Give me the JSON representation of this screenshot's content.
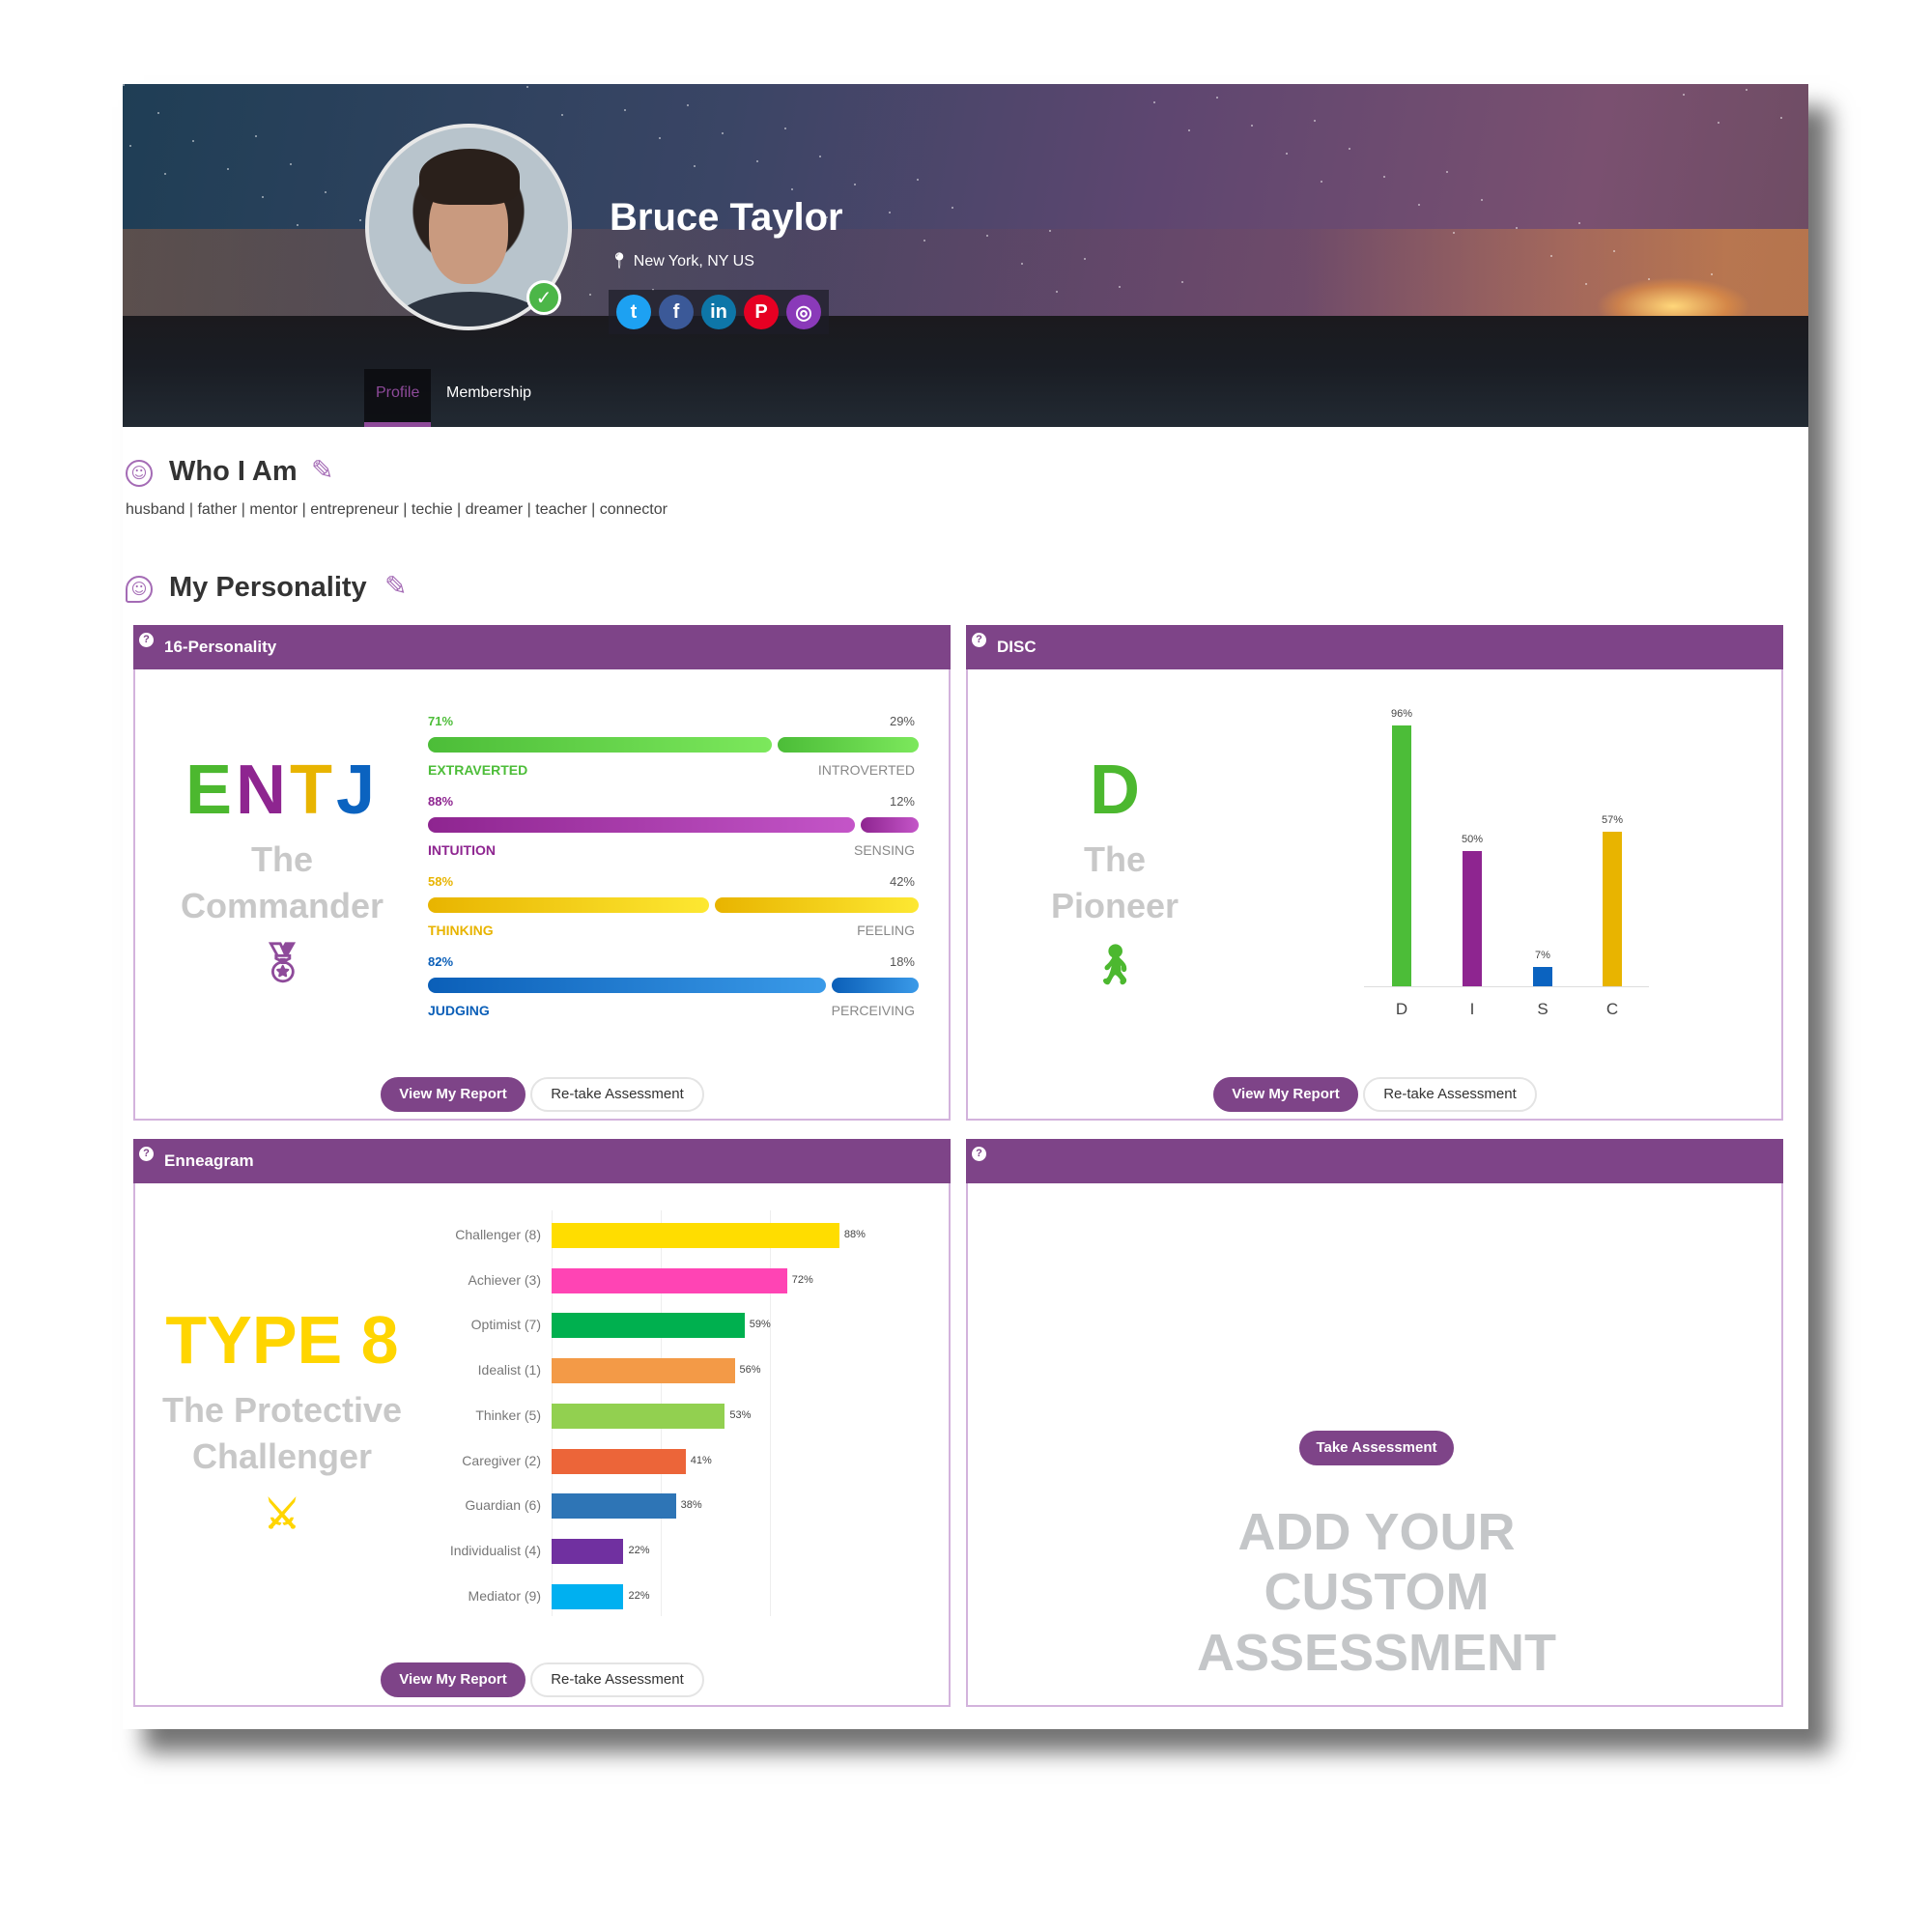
{
  "profile": {
    "name": "Bruce Taylor",
    "location": "New York, NY US",
    "verified": true,
    "social": [
      {
        "icon": "twitter-icon",
        "glyph": "t",
        "color": "#1da1f2"
      },
      {
        "icon": "facebook-icon",
        "glyph": "f",
        "color": "#3b5998"
      },
      {
        "icon": "linkedin-icon",
        "glyph": "in",
        "color": "#0e76a8"
      },
      {
        "icon": "pinterest-icon",
        "glyph": "P",
        "color": "#e60023"
      },
      {
        "icon": "instagram-icon",
        "glyph": "◎",
        "color": "#8a3ab9"
      }
    ]
  },
  "tabs": [
    {
      "label": "Profile",
      "active": true
    },
    {
      "label": "Membership",
      "active": false
    }
  ],
  "who_i_am": {
    "title": "Who I Am",
    "tags": "husband | father | mentor | entrepreneur | techie | dreamer | teacher | connector"
  },
  "personality": {
    "title": "My Personality"
  },
  "colors": {
    "accent": "#7e4488"
  },
  "sixteen": {
    "title": "16-Personality",
    "type": "ENTJ",
    "type_colors": [
      "#4cb82f",
      "#8e2590",
      "#e8b400",
      "#0b63c0"
    ],
    "name_line1": "The",
    "name_line2": "Commander",
    "icon": "medal-icon",
    "rows": [
      {
        "left": "EXTRAVERTED",
        "right": "INTROVERTED",
        "left_pct": 71,
        "right_pct": 29,
        "left_label": "71%",
        "right_label": "29%",
        "color": "#4cbd38",
        "light": "#7ce85c"
      },
      {
        "left": "INTUITION",
        "right": "SENSING",
        "left_pct": 88,
        "right_pct": 12,
        "left_label": "88%",
        "right_label": "12%",
        "color": "#8e2590",
        "light": "#c455c8"
      },
      {
        "left": "THINKING",
        "right": "FEELING",
        "left_pct": 58,
        "right_pct": 42,
        "left_label": "58%",
        "right_label": "42%",
        "color": "#e8b400",
        "light": "#fde832"
      },
      {
        "left": "JUDGING",
        "right": "PERCEIVING",
        "left_pct": 82,
        "right_pct": 18,
        "left_label": "82%",
        "right_label": "18%",
        "color": "#0b5fb8",
        "light": "#3a9ae8"
      }
    ],
    "view": "View My Report",
    "retake": "Re-take Assessment"
  },
  "disc": {
    "title": "DISC",
    "letter": "D",
    "letter_color": "#4cb82f",
    "name_line1": "The",
    "name_line2": "Pioneer",
    "icon": "hiker-icon",
    "view": "View My Report",
    "retake": "Re-take Assessment"
  },
  "enneagram": {
    "title": "Enneagram",
    "type": "TYPE 8",
    "type_color": "#ffd500",
    "name_line1": "The Protective",
    "name_line2": "Challenger",
    "icon": "crossed-swords-icon",
    "view": "View My Report",
    "retake": "Re-take Assessment"
  },
  "custom": {
    "title": "",
    "button": "Take Assessment",
    "line1": "ADD YOUR",
    "line2": "CUSTOM",
    "line3": "ASSESSMENT"
  },
  "chart_data": [
    {
      "type": "bar",
      "orientation": "vertical",
      "categories": [
        "D",
        "I",
        "S",
        "C"
      ],
      "values": [
        96,
        50,
        7,
        57
      ],
      "labels": [
        "96%",
        "50%",
        "7%",
        "57%"
      ],
      "colors": [
        "#4cbd38",
        "#8e2590",
        "#0b63c0",
        "#e8b400"
      ],
      "ylim": [
        0,
        100
      ],
      "grid": false
    },
    {
      "type": "bar",
      "orientation": "horizontal",
      "categories": [
        "Challenger (8)",
        "Achiever (3)",
        "Optimist (7)",
        "Idealist (1)",
        "Thinker (5)",
        "Caregiver (2)",
        "Guardian (6)",
        "Individualist (4)",
        "Mediator (9)"
      ],
      "values": [
        88,
        72,
        59,
        56,
        53,
        41,
        38,
        22,
        22
      ],
      "labels": [
        "88%",
        "72%",
        "59%",
        "56%",
        "53%",
        "41%",
        "38%",
        "22%",
        "22%"
      ],
      "colors": [
        "#ffdd00",
        "#ff44b4",
        "#00b04f",
        "#f39a47",
        "#92d050",
        "#ec6539",
        "#2e75b6",
        "#7030a0",
        "#00b0f0"
      ],
      "xlim": [
        0,
        100
      ],
      "grid": true
    }
  ]
}
